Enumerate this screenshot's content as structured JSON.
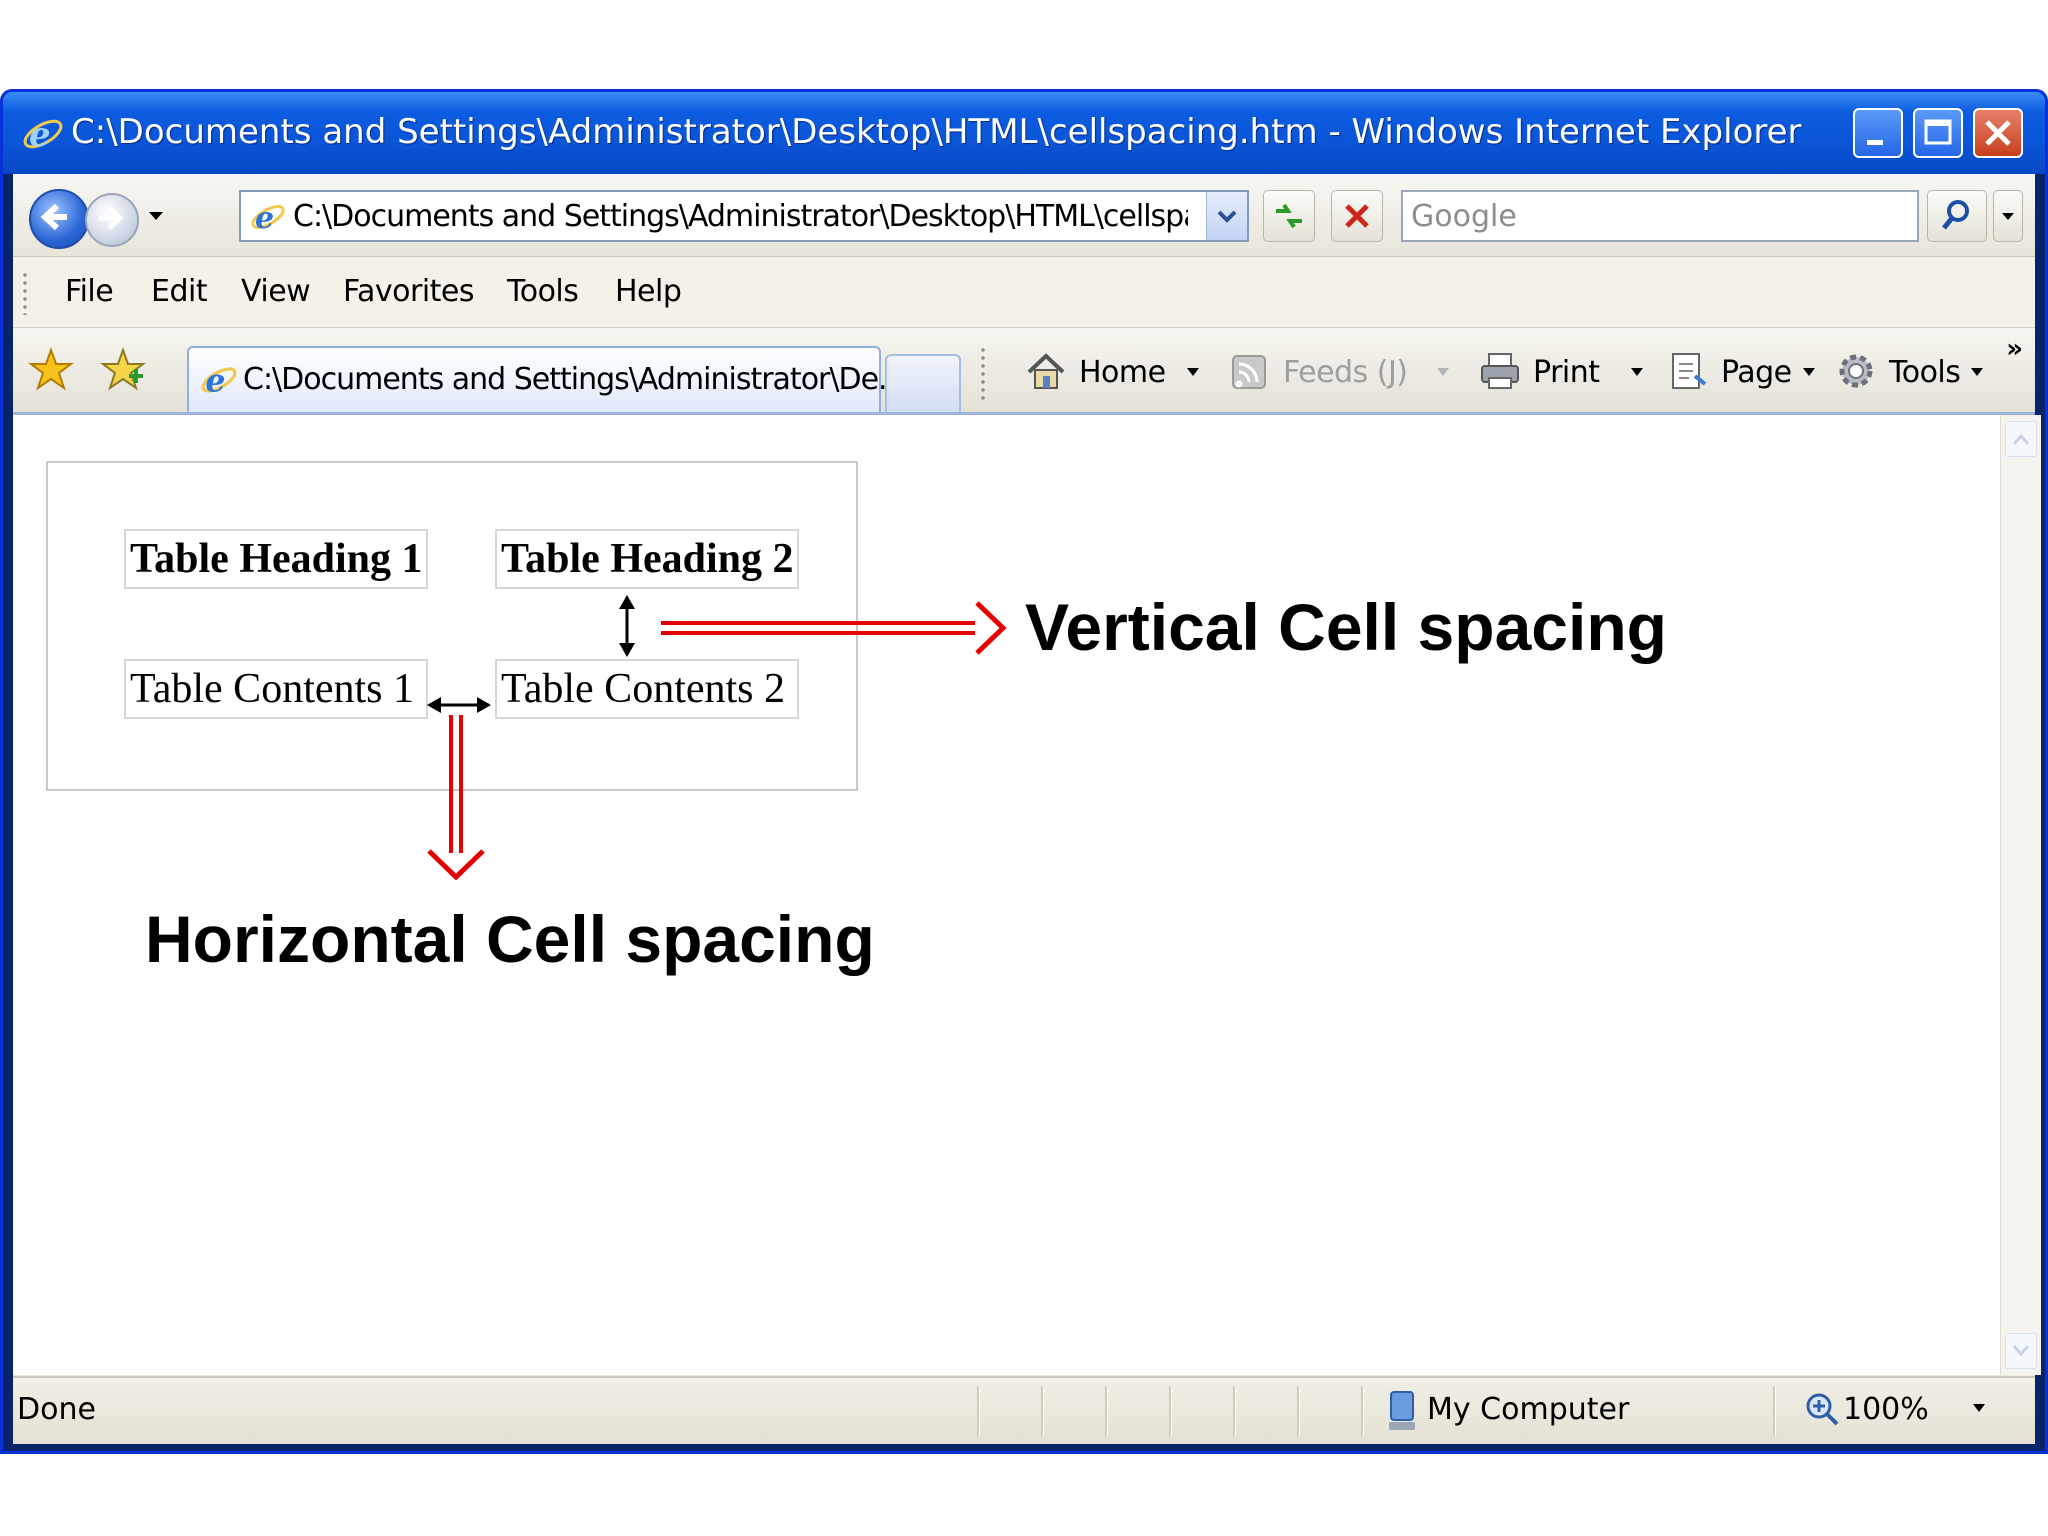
{
  "window": {
    "title": "C:\\Documents and Settings\\Administrator\\Desktop\\HTML\\cellspacing.htm - Windows Internet Explorer"
  },
  "address_bar": {
    "value": "C:\\Documents and Settings\\Administrator\\Desktop\\HTML\\cellspacing.h"
  },
  "search": {
    "placeholder": "Google"
  },
  "menu": {
    "items": [
      "File",
      "Edit",
      "View",
      "Favorites",
      "Tools",
      "Help"
    ]
  },
  "tab": {
    "label": "C:\\Documents and Settings\\Administrator\\De..."
  },
  "command_bar": {
    "home": "Home",
    "feeds": "Feeds (J)",
    "print": "Print",
    "page": "Page",
    "tools": "Tools"
  },
  "content": {
    "table": {
      "headers": [
        "Table Heading 1",
        "Table Heading 2"
      ],
      "row": [
        "Table Contents 1",
        "Table Contents 2"
      ]
    },
    "annotations": {
      "vertical": "Vertical Cell spacing",
      "horizontal": "Horizontal Cell spacing"
    },
    "arrow_color": "#e60000"
  },
  "status_bar": {
    "status": "Done",
    "zone": "My Computer",
    "zoom": "100%"
  },
  "colors": {
    "titlebar": "#0a55d8",
    "chrome": "#ece9d8"
  }
}
